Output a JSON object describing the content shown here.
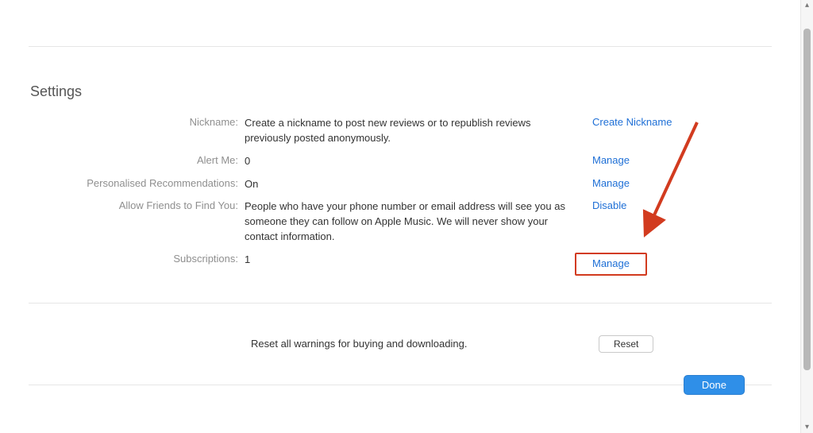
{
  "title": "Settings",
  "rows": {
    "nickname": {
      "label": "Nickname:",
      "value": "Create a nickname to post new reviews or to republish reviews previously posted anonymously.",
      "action": "Create Nickname"
    },
    "alert": {
      "label": "Alert Me:",
      "value": "0",
      "action": "Manage"
    },
    "recs": {
      "label": "Personalised Recommendations:",
      "value": "On",
      "action": "Manage"
    },
    "friends": {
      "label": "Allow Friends to Find You:",
      "value": "People who have your phone number or email address will see you as someone they can follow on Apple Music. We will never show your contact information.",
      "action": "Disable"
    },
    "subs": {
      "label": "Subscriptions:",
      "value": "1",
      "action": "Manage"
    }
  },
  "reset": {
    "text": "Reset all warnings for buying and downloading.",
    "button": "Reset"
  },
  "done": "Done",
  "annotation": {
    "highlight_target": "subs_manage",
    "arrow_color": "#d23b1f"
  }
}
